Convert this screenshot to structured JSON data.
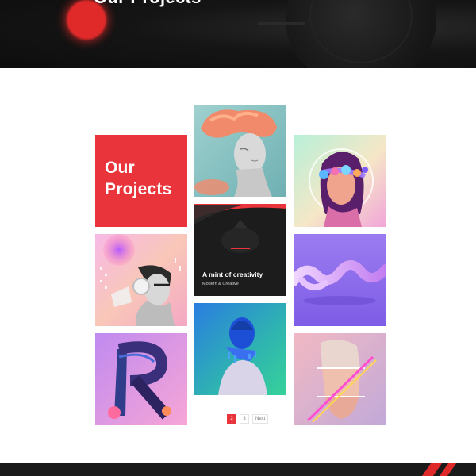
{
  "hero": {
    "title": "Our Projects"
  },
  "gallery": {
    "intro": {
      "title_line_1": "Our",
      "title_line_2": "Projects"
    },
    "featured": {
      "title": "A mint of creativity",
      "subtitle": "Modern & Creative"
    },
    "tiles": [
      {
        "name": "coral-sculpture-portrait"
      },
      {
        "name": "planet-headset-portrait"
      },
      {
        "name": "headphones-man-portrait"
      },
      {
        "name": "a-mint-of-creativity"
      },
      {
        "name": "evolution-3d-type"
      },
      {
        "name": "r-letter-3d-art"
      },
      {
        "name": "blue-glitch-figure"
      },
      {
        "name": "fractured-face-portrait"
      }
    ]
  },
  "pagination": {
    "pages": [
      "2",
      "3"
    ],
    "active_page": "2",
    "next_label": "Next"
  },
  "colors": {
    "accent": "#e8343a",
    "hero_background": "#141414",
    "footer_background": "#1a1a1a"
  }
}
